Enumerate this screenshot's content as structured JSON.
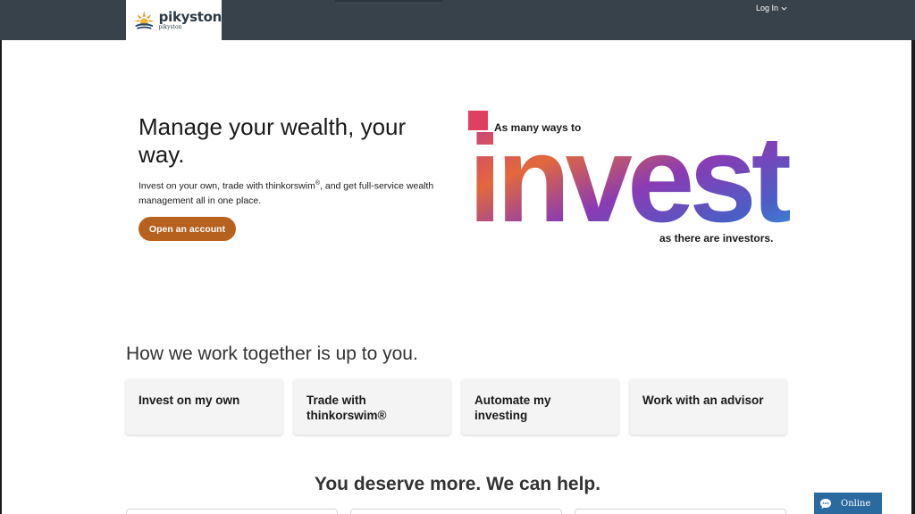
{
  "header": {
    "brand_name": "pikyston",
    "brand_sub": "pikyston",
    "login_label": "Log In"
  },
  "hero": {
    "title": "Manage your wealth, your way.",
    "desc_prefix": "Invest on your own, trade with thinkorswim",
    "desc_mark": "®",
    "desc_suffix": ", and get full-service wealth management all in one place.",
    "cta_label": "Open an account"
  },
  "promo": {
    "top_line": "As many ways to",
    "big_word": "invest",
    "bottom_line": "as there are investors."
  },
  "together": {
    "title": "How we work together is up to you.",
    "cards": [
      {
        "label": "Invest on my own"
      },
      {
        "label": "Trade with thinkorswim®"
      },
      {
        "label": "Automate my investing"
      },
      {
        "label": "Work with an advisor"
      }
    ]
  },
  "help": {
    "title": "You deserve more. We can help."
  },
  "chat": {
    "label": "Online"
  },
  "colors": {
    "topbar": "#37424a",
    "cta": "#b7611e",
    "chat": "#2b6a9e",
    "promo_square": "#e0405f"
  }
}
